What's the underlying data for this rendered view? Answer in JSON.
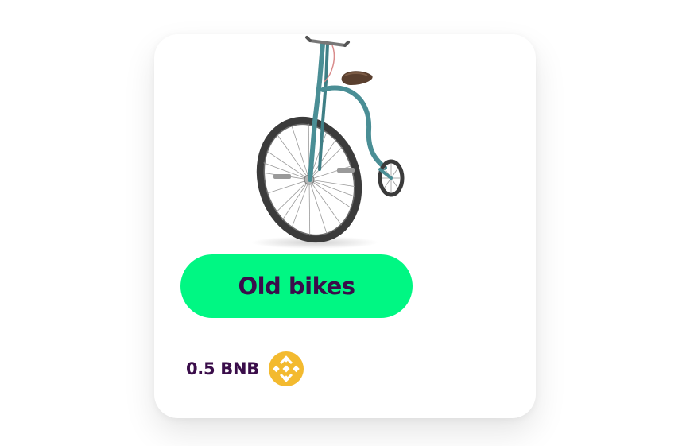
{
  "card": {
    "title": "Old bikes",
    "price": "0.5 BNB"
  },
  "icons": {
    "item_image": "penny-farthing-bicycle-icon",
    "currency": "bnb-coin-icon"
  },
  "colors": {
    "button_bg": "#00f783",
    "title_text": "#3a0d4a",
    "price_text": "#3a0d4a",
    "coin": "#f3ba2f",
    "bike_frame": "#4a8e95",
    "tire": "#3b3b3b"
  }
}
